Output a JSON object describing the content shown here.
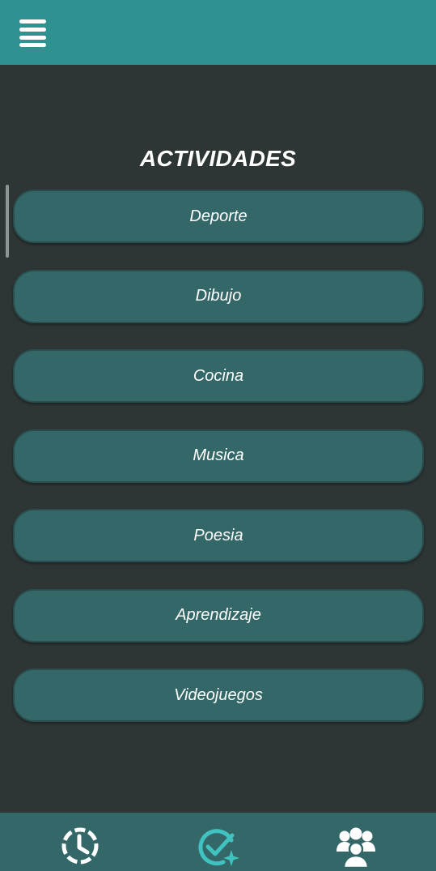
{
  "header": {
    "menu_icon": "hamburger-menu-icon"
  },
  "main": {
    "title": "ACTIVIDADES",
    "activities": [
      {
        "label": "Deporte"
      },
      {
        "label": "Dibujo"
      },
      {
        "label": "Cocina"
      },
      {
        "label": "Musica"
      },
      {
        "label": "Poesia"
      },
      {
        "label": "Aprendizaje"
      },
      {
        "label": "Videojuegos"
      }
    ]
  },
  "bottom_nav": {
    "items": [
      {
        "icon": "history-clock-icon"
      },
      {
        "icon": "activities-check-sparkle-icon",
        "active": true
      },
      {
        "icon": "community-group-icon"
      }
    ]
  },
  "colors": {
    "header_bg": "#2e9390",
    "page_bg": "#2d3535",
    "button_bg": "#346868",
    "nav_bg": "#346868",
    "accent": "#3fc2c0",
    "text": "#ffffff"
  }
}
